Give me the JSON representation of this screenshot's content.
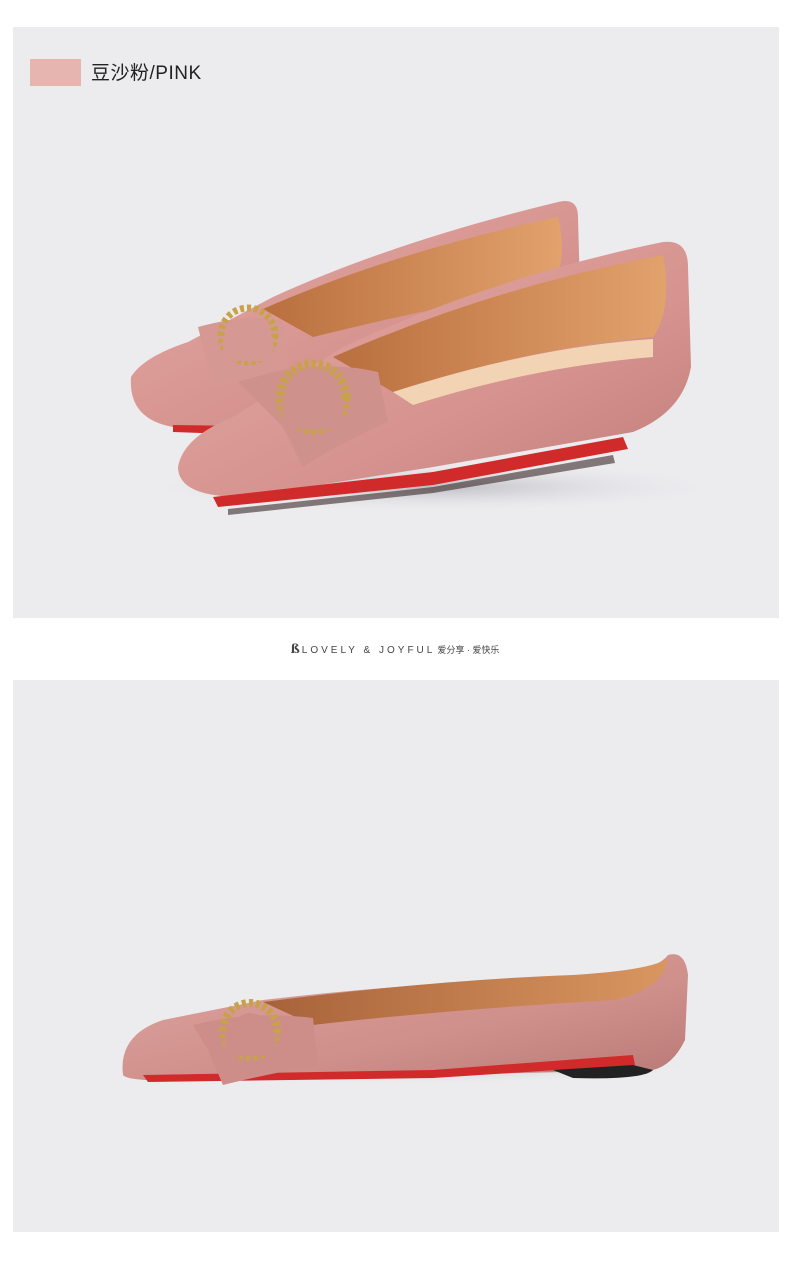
{
  "color_option": {
    "swatch_color": "#e7b5b0",
    "label": "豆沙粉/PINK"
  },
  "tagline": {
    "brand_mark": "ß",
    "text": "LOVELY & JOYFUL",
    "chinese": "爱分享 · 爱快乐"
  },
  "colors": {
    "background": "#ececef",
    "suede": "#d99a96",
    "lining": "#d9965e",
    "sole": "#d12a2a"
  }
}
